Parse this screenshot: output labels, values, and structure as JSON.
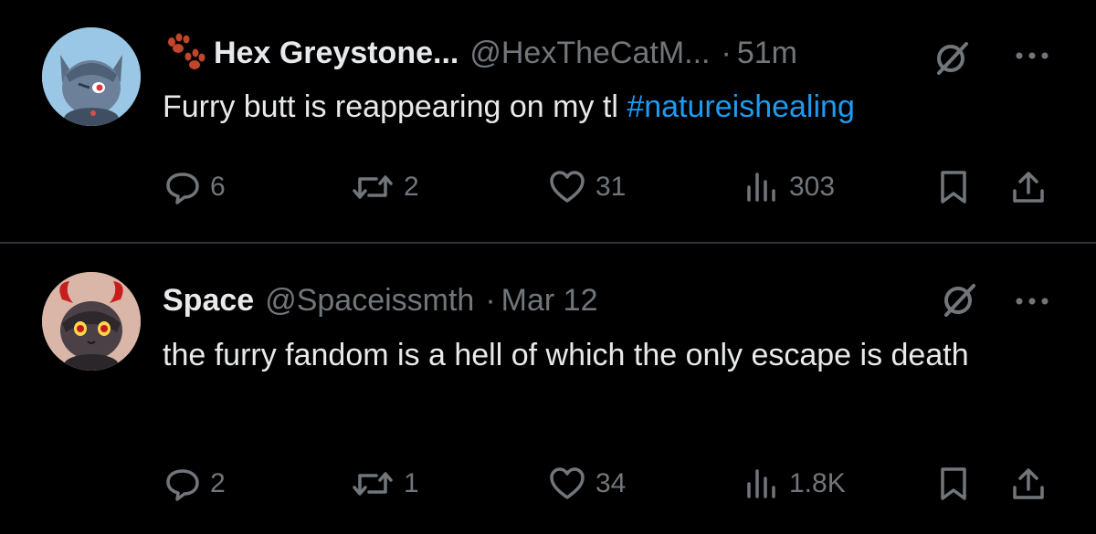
{
  "tweets": [
    {
      "author": {
        "display_name": "Hex Greystone...",
        "handle": "@HexTheCatM...",
        "name_prefix_icon": "paw-prints-icon"
      },
      "separator": "·",
      "time": "51m",
      "text": "Furry butt is reappearing on my tl ",
      "hashtag": "#natureishealing",
      "stats": {
        "replies": "6",
        "reposts": "2",
        "likes": "31",
        "views": "303"
      }
    },
    {
      "author": {
        "display_name": "Space",
        "handle": "@Spaceissmth"
      },
      "separator": "·",
      "time": "Mar 12",
      "text": "the furry fandom is a hell of which the only escape is death",
      "stats": {
        "replies": "2",
        "reposts": "1",
        "likes": "34",
        "views": "1.8K"
      }
    }
  ],
  "colors": {
    "background": "#000000",
    "primary_text": "#e7e9ea",
    "secondary_text": "#71767b",
    "link": "#1d9bf0",
    "divider": "#2f3336"
  },
  "icons": [
    "reply-icon",
    "repost-icon",
    "like-icon",
    "views-icon",
    "bookmark-icon",
    "share-icon",
    "grok-icon",
    "more-icon"
  ]
}
